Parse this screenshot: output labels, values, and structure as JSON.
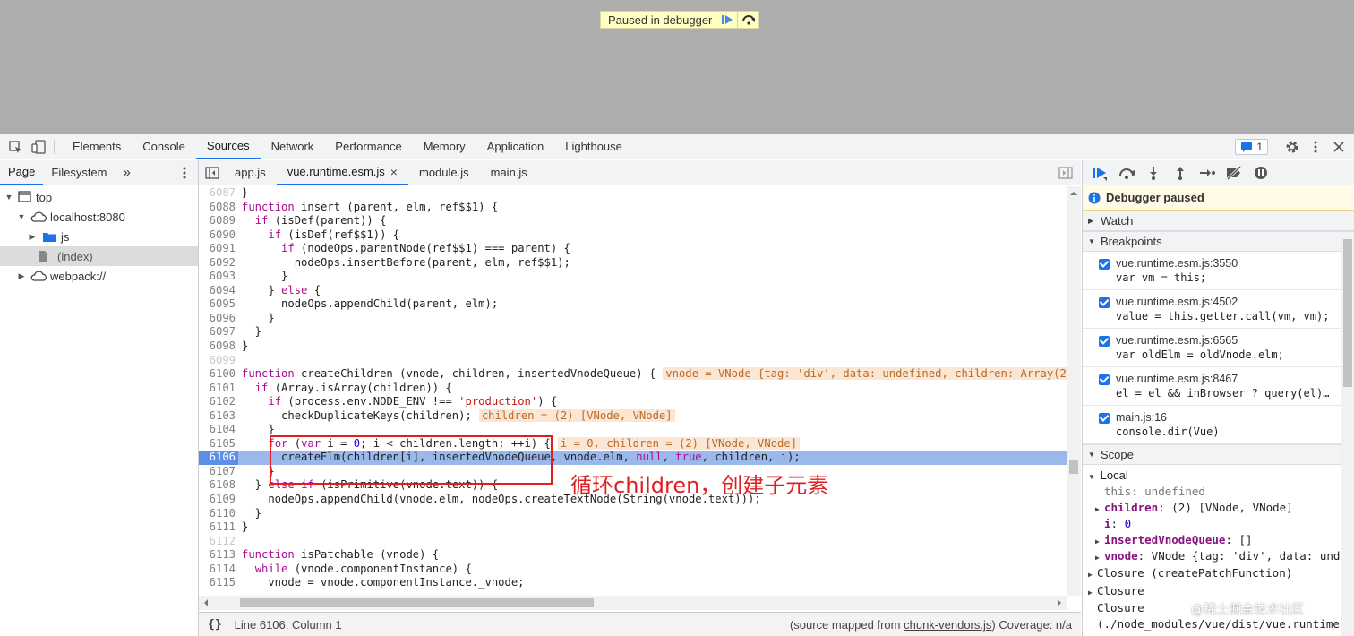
{
  "page": {
    "paused_text": "Paused in debugger"
  },
  "toolbar": {
    "tabs": [
      "Elements",
      "Console",
      "Sources",
      "Network",
      "Performance",
      "Memory",
      "Application",
      "Lighthouse"
    ],
    "active_tab": "Sources",
    "issues_count": "1"
  },
  "navigator": {
    "tabs": [
      "Page",
      "Filesystem"
    ],
    "more": "»",
    "tree": [
      "top",
      "localhost:8080",
      "js",
      "(index)",
      "webpack://"
    ]
  },
  "editor": {
    "file_tabs": [
      "app.js",
      "vue.runtime.esm.js",
      "module.js",
      "main.js"
    ],
    "close_glyph": "×",
    "status_position": "Line 6106, Column 1",
    "status_mapped_prefix": "(source mapped from ",
    "status_mapped_file": "chunk-vendors.js",
    "status_mapped_suffix": ")  Coverage: n/a",
    "lines": [
      {
        "n": "6087",
        "dim": true,
        "code": "}"
      },
      {
        "n": "6088",
        "code": "function insert (parent, elm, ref$$1) {"
      },
      {
        "n": "6089",
        "code": "  if (isDef(parent)) {"
      },
      {
        "n": "6090",
        "code": "    if (isDef(ref$$1)) {"
      },
      {
        "n": "6091",
        "code": "      if (nodeOps.parentNode(ref$$1) === parent) {"
      },
      {
        "n": "6092",
        "code": "        nodeOps.insertBefore(parent, elm, ref$$1);"
      },
      {
        "n": "6093",
        "code": "      }"
      },
      {
        "n": "6094",
        "code": "    } else {"
      },
      {
        "n": "6095",
        "code": "      nodeOps.appendChild(parent, elm);"
      },
      {
        "n": "6096",
        "code": "    }"
      },
      {
        "n": "6097",
        "code": "  }"
      },
      {
        "n": "6098",
        "code": "}"
      },
      {
        "n": "6099",
        "dim": true,
        "code": ""
      },
      {
        "n": "6100",
        "code": "function createChildren (vnode, children, insertedVnodeQueue) {",
        "inline": "vnode = VNode {tag: 'div', data: undefined, children: Array(2)"
      },
      {
        "n": "6101",
        "code": "  if (Array.isArray(children)) {"
      },
      {
        "n": "6102",
        "code": "    if (process.env.NODE_ENV !== 'production') {"
      },
      {
        "n": "6103",
        "code": "      checkDuplicateKeys(children);",
        "inline": "children = (2) [VNode, VNode]"
      },
      {
        "n": "6104",
        "code": "    }"
      },
      {
        "n": "6105",
        "code": "    for (var i = 0; i < children.length; ++i) {",
        "inline": "i = 0, children = (2) [VNode, VNode]"
      },
      {
        "n": "6106",
        "exec": true,
        "code": "      createElm(children[i], insertedVnodeQueue, vnode.elm, null, true, children, i);"
      },
      {
        "n": "6107",
        "code": "    }"
      },
      {
        "n": "6108",
        "code": "  } else if (isPrimitive(vnode.text)) {"
      },
      {
        "n": "6109",
        "code": "    nodeOps.appendChild(vnode.elm, nodeOps.createTextNode(String(vnode.text)));"
      },
      {
        "n": "6110",
        "code": "  }"
      },
      {
        "n": "6111",
        "code": "}"
      },
      {
        "n": "6112",
        "dim": true,
        "code": ""
      },
      {
        "n": "6113",
        "code": "function isPatchable (vnode) {"
      },
      {
        "n": "6114",
        "code": "  while (vnode.componentInstance) {"
      },
      {
        "n": "6115",
        "code": "    vnode = vnode.componentInstance._vnode;"
      }
    ]
  },
  "annotation": {
    "text": "循环children，创建子元素"
  },
  "debugger": {
    "paused_banner": "Debugger paused",
    "watch_label": "Watch",
    "breakpoints_label": "Breakpoints",
    "breakpoints": [
      {
        "file": "vue.runtime.esm.js:3550",
        "code": "var vm = this;"
      },
      {
        "file": "vue.runtime.esm.js:4502",
        "code": "value = this.getter.call(vm, vm);"
      },
      {
        "file": "vue.runtime.esm.js:6565",
        "code": "var oldElm = oldVnode.elm;"
      },
      {
        "file": "vue.runtime.esm.js:8467",
        "code": "el = el && inBrowser ? query(el)…"
      },
      {
        "file": "main.js:16",
        "code": "console.dir(Vue)"
      }
    ],
    "scope_label": "Scope",
    "local_label": "Local",
    "scope": {
      "this_name": "this",
      "this_val": ": undefined",
      "children_name": "children",
      "children_val": ": (2) [VNode, VNode]",
      "i_name": "i",
      "i_val": "0",
      "ivq_name": "insertedVnodeQueue",
      "ivq_val": ": []",
      "vnode_name": "vnode",
      "vnode_val": ": VNode {tag: 'div', data: undef"
    },
    "closures": [
      "Closure (createPatchFunction)",
      "Closure",
      "Closure",
      "(./node_modules/vue/dist/vue.runtime."
    ]
  },
  "watermark": "@稀土掘金技术社区",
  "colors": {
    "accent": "#1a73e8",
    "exec_line": "#9bb8ec",
    "annotation": "#e02020"
  }
}
